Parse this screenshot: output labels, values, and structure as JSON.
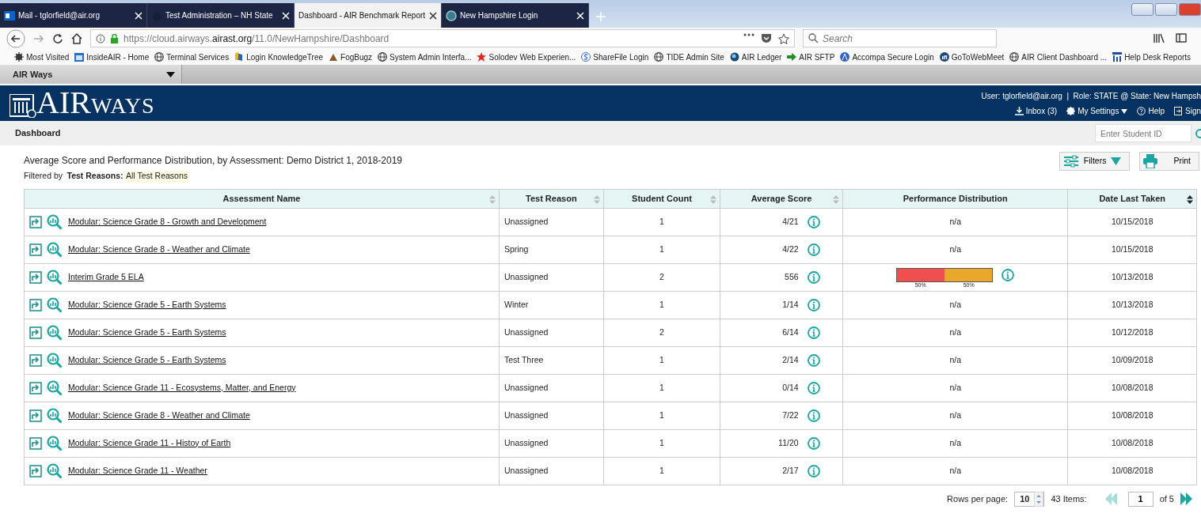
{
  "browser": {
    "tabs": [
      {
        "title": "Mail - tglorfield@air.org",
        "selected": false
      },
      {
        "title": "Test Administration – NH State",
        "selected": false
      },
      {
        "title": "Dashboard - AIR Benchmark Report",
        "selected": true
      },
      {
        "title": "New Hampshire Login",
        "selected": false
      }
    ],
    "url_prefix": "https://cloud.airways.",
    "url_domain": "airast.org",
    "url_path": "/11.0/NewHampshire/Dashboard",
    "search_placeholder": "Search",
    "bookmarks": [
      "Most Visited",
      "InsideAIR - Home",
      "Terminal Services",
      "Login  KnowledgeTree",
      "FogBugz",
      "System Admin Interfa...",
      "Solodev Web Experien...",
      "ShareFile Login",
      "TIDE Admin Site",
      "AIR Ledger",
      "AIR SFTP",
      "Accompa Secure Login",
      "GoToWebMeet",
      "AIR Client Dashboard ...",
      "Help Desk Reports"
    ]
  },
  "app_menu": "AIR Ways",
  "header": {
    "logo_main": "AIR",
    "logo_sub": "WAYS",
    "user": "User: tglorfield@air.org",
    "separator": "|",
    "role": "Role: STATE @ State: New Hampsh",
    "links": [
      "Inbox (3)",
      "My Settings",
      "Help",
      "Sign"
    ]
  },
  "page_title": "Dashboard",
  "student_search_placeholder": "Enter Student ID",
  "report": {
    "title": "Average Score and Performance Distribution, by Assessment: Demo District 1, 2018-2019",
    "filter_prefix": "Filtered by",
    "filter_name": "Test Reasons:",
    "filter_value": "All Test Reasons",
    "buttons": [
      "Filters",
      "Print"
    ]
  },
  "table": {
    "columns": [
      {
        "label": "Assessment Name",
        "sortable": true,
        "sorted": false
      },
      {
        "label": "Test Reason",
        "sortable": true,
        "sorted": false
      },
      {
        "label": "Student Count",
        "sortable": true,
        "sorted": false
      },
      {
        "label": "Average Score",
        "sortable": true,
        "sorted": false
      },
      {
        "label": "Performance Distribution",
        "sortable": false
      },
      {
        "label": "Date Last Taken",
        "sortable": true,
        "sorted": true
      }
    ],
    "rows": [
      {
        "name": "Modular: Science Grade 8 - Growth and Development",
        "reason": "Unassigned",
        "count": "1",
        "score": "4/21",
        "distribution": "n/a",
        "date": "10/15/2018"
      },
      {
        "name": "Modular: Science Grade 8 - Weather and Climate",
        "reason": "Spring",
        "count": "1",
        "score": "4/22",
        "distribution": "n/a",
        "date": "10/15/2018"
      },
      {
        "name": "Interim Grade 5 ELA",
        "reason": "Unassigned",
        "count": "2",
        "score": "556",
        "segments": [
          {
            "level": 0.5,
            "label": "50%",
            "color": "#ef4f4f"
          },
          {
            "level": 0.5,
            "label": "50%",
            "color": "#e9a82c"
          }
        ],
        "date": "10/13/2018"
      },
      {
        "name": "Modular: Science Grade 5 - Earth Systems",
        "reason": "Winter",
        "count": "1",
        "score": "1/14",
        "distribution": "n/a",
        "date": "10/13/2018"
      },
      {
        "name": "Modular: Science Grade 5 - Earth Systems",
        "reason": "Unassigned",
        "count": "2",
        "score": "6/14",
        "distribution": "n/a",
        "date": "10/12/2018"
      },
      {
        "name": "Modular: Science Grade 5 - Earth Systems",
        "reason": "Test Three",
        "count": "1",
        "score": "2/14",
        "distribution": "n/a",
        "date": "10/09/2018"
      },
      {
        "name": "Modular: Science Grade 11 - Ecosystems, Matter, and Energy",
        "reason": "Unassigned",
        "count": "1",
        "score": "0/14",
        "distribution": "n/a",
        "date": "10/08/2018"
      },
      {
        "name": "Modular: Science Grade 8 - Weather and Climate",
        "reason": "Unassigned",
        "count": "1",
        "score": "7/22",
        "distribution": "n/a",
        "date": "10/08/2018"
      },
      {
        "name": "Modular: Science Grade 11 - Histoy of Earth",
        "reason": "Unassigned",
        "count": "1",
        "score": "11/20",
        "distribution": "n/a",
        "date": "10/08/2018"
      },
      {
        "name": "Modular: Science Grade 11 - Weather",
        "reason": "Unassigned",
        "count": "1",
        "score": "2/17",
        "distribution": "n/a",
        "date": "10/08/2018"
      }
    ]
  },
  "pagination": {
    "rows_label": "Rows per page:",
    "rows_value": "10",
    "items": "43 Items:",
    "page": "1",
    "of": "of 5",
    "prev_disabled": true,
    "next_disabled": false
  }
}
